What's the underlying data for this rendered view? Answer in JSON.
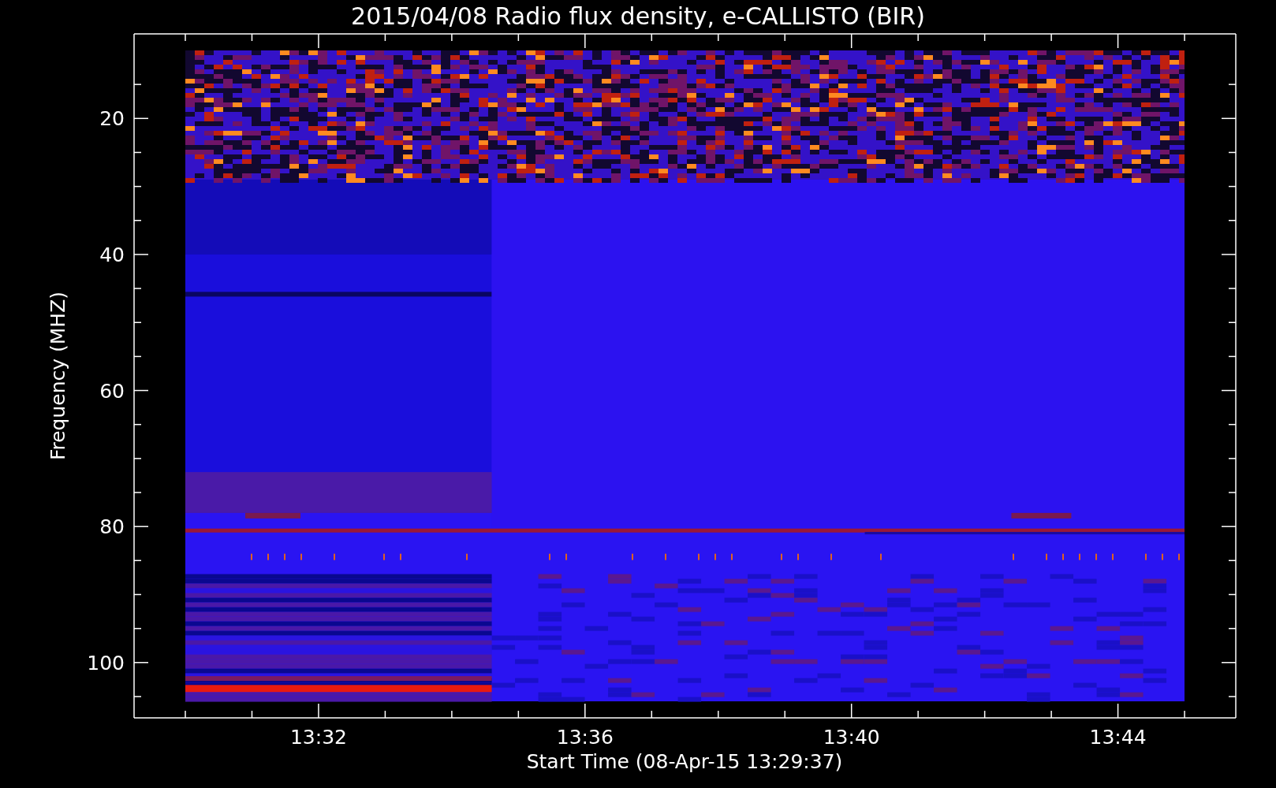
{
  "title": "2015/04/08  Radio flux density, e-CALLISTO (BIR)",
  "y_axis": {
    "label": "Frequency (MHZ)",
    "ticks": [
      "20",
      "40",
      "60",
      "80",
      "100"
    ]
  },
  "x_axis": {
    "label": "Start Time (08-Apr-15 13:29:37)",
    "ticks": [
      "13:32",
      "13:36",
      "13:40",
      "13:44"
    ]
  }
}
